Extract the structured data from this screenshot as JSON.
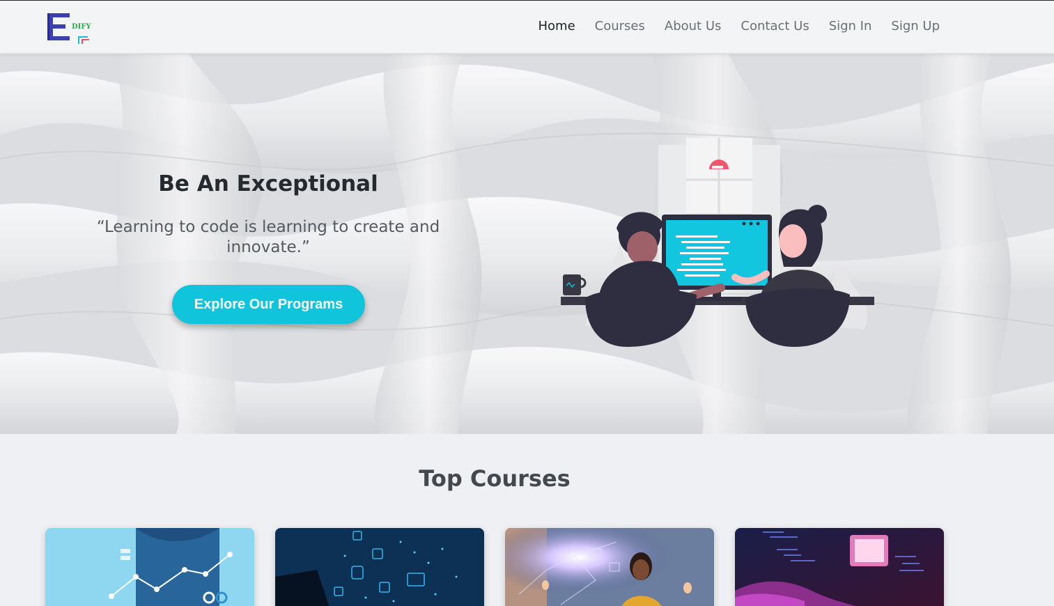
{
  "brand": {
    "logo_letter": "E",
    "logo_text": "DIFY"
  },
  "nav": {
    "items": [
      {
        "label": "Home",
        "active": true
      },
      {
        "label": "Courses",
        "active": false
      },
      {
        "label": "About Us",
        "active": false
      },
      {
        "label": "Contact Us",
        "active": false
      },
      {
        "label": "Sign In",
        "active": false
      },
      {
        "label": "Sign Up",
        "active": false
      }
    ]
  },
  "hero": {
    "title": "Be An Exceptional",
    "quote": "“Learning to code is learning to create and innovate.”",
    "cta_label": "Explore Our Programs"
  },
  "courses": {
    "title": "Top Courses",
    "cards": [
      {
        "image": "analytics-chart-image"
      },
      {
        "image": "cyber-network-image"
      },
      {
        "image": "ai-hologram-image"
      },
      {
        "image": "coding-keyboard-image"
      }
    ]
  },
  "colors": {
    "accent": "#10c4dc",
    "logo_blue": "#3b3fb0",
    "logo_green": "#2aa84a",
    "nav_text": "#6b6f73",
    "nav_active": "#1d2125"
  }
}
